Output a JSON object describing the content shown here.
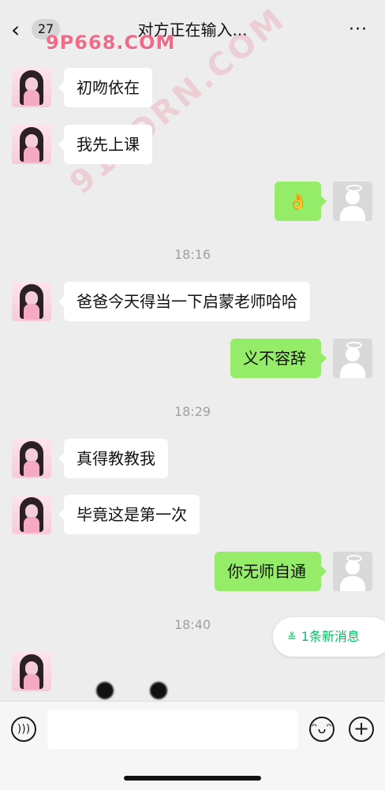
{
  "header": {
    "back_glyph": "‹",
    "unread_count": "27",
    "title": "对方正在输入...",
    "more_glyph": "···"
  },
  "watermarks": {
    "top": "9P668.COM",
    "diagonal": "91PORN.COM"
  },
  "messages": [
    {
      "side": "left",
      "text": "初吻依在"
    },
    {
      "side": "left",
      "text": "我先上课"
    },
    {
      "side": "right",
      "text": "👌"
    },
    {
      "side": "time",
      "text": "18:16"
    },
    {
      "side": "left",
      "text": "爸爸今天得当一下启蒙老师哈哈"
    },
    {
      "side": "right",
      "text": "义不容辞"
    },
    {
      "side": "time",
      "text": "18:29"
    },
    {
      "side": "left",
      "text": "真得教教我"
    },
    {
      "side": "left",
      "text": "毕竟这是第一次"
    },
    {
      "side": "right",
      "text": "你无师自通"
    },
    {
      "side": "time",
      "text": "18:40"
    }
  ],
  "new_message_pill": {
    "chevron": "≚",
    "label": "1条新消息",
    "color": "#07c160"
  },
  "composer": {
    "voice_icon": "voice-icon",
    "input_value": "",
    "emoji_icon": "emoji-icon",
    "plus_icon": "plus-icon"
  },
  "colors": {
    "bubble_right": "#95ec69",
    "bubble_left": "#ffffff",
    "background": "#ededed"
  }
}
